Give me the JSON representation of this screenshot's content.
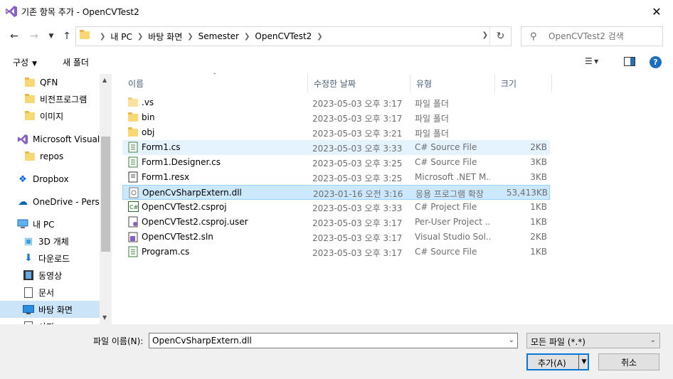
{
  "window": {
    "title": "기존 항목 추가 - OpenCVTest2",
    "close_glyph": "✕"
  },
  "address": {
    "crumbs": [
      "내 PC",
      "바탕 화면",
      "Semester",
      "OpenCVTest2"
    ],
    "search_placeholder": "OpenCVTest2 검색"
  },
  "toolbar": {
    "organize_label": "구성",
    "new_folder_label": "새 폴더",
    "help_label": "?"
  },
  "nav": {
    "items": [
      {
        "label": "QFN",
        "icon": "folder-icon"
      },
      {
        "label": "비전프로그램",
        "icon": "folder-icon"
      },
      {
        "label": "이미지",
        "icon": "folder-icon"
      },
      {
        "label": "Microsoft Visual S",
        "icon": "visual-studio-icon"
      },
      {
        "label": "repos",
        "icon": "folder-icon"
      },
      {
        "label": "Dropbox",
        "icon": "dropbox-icon"
      },
      {
        "label": "OneDrive - Person",
        "icon": "onedrive-icon"
      },
      {
        "label": "내 PC",
        "icon": "computer-icon"
      },
      {
        "label": "3D 개체",
        "icon": "3d-objects-icon"
      },
      {
        "label": "다운로드",
        "icon": "download-icon"
      },
      {
        "label": "동영상",
        "icon": "video-icon"
      },
      {
        "label": "문서",
        "icon": "documents-icon"
      },
      {
        "label": "바탕 화면",
        "icon": "desktop-icon"
      },
      {
        "label": "사진",
        "icon": "pictures-icon"
      }
    ]
  },
  "columns": {
    "name": "이름",
    "date": "수정한 날짜",
    "type": "유형",
    "size": "크기"
  },
  "files": [
    {
      "name": ".vs",
      "date": "2023-05-03 오후 3:17",
      "type": "파일 폴더",
      "size": "",
      "icon": "folder-icon"
    },
    {
      "name": "bin",
      "date": "2023-05-03 오후 3:17",
      "type": "파일 폴더",
      "size": "",
      "icon": "folder-icon"
    },
    {
      "name": "obj",
      "date": "2023-05-03 오후 3:21",
      "type": "파일 폴더",
      "size": "",
      "icon": "folder-icon"
    },
    {
      "name": "Form1.cs",
      "date": "2023-05-03 오후 3:33",
      "type": "C# Source File",
      "size": "2KB",
      "icon": "csharp-file-icon"
    },
    {
      "name": "Form1.Designer.cs",
      "date": "2023-05-03 오후 3:25",
      "type": "C# Source File",
      "size": "3KB",
      "icon": "csharp-file-icon"
    },
    {
      "name": "Form1.resx",
      "date": "2023-05-03 오후 3:25",
      "type": "Microsoft .NET M...",
      "size": "3KB",
      "icon": "resx-file-icon"
    },
    {
      "name": "OpenCvSharpExtern.dll",
      "date": "2023-01-16 오전 3:16",
      "type": "응용 프로그램 확장",
      "size": "53,413KB",
      "icon": "dll-file-icon"
    },
    {
      "name": "OpenCVTest2.csproj",
      "date": "2023-05-03 오후 3:33",
      "type": "C# Project File",
      "size": "1KB",
      "icon": "csproj-file-icon"
    },
    {
      "name": "OpenCVTest2.csproj.user",
      "date": "2023-05-03 오후 3:17",
      "type": "Per-User Project ...",
      "size": "1KB",
      "icon": "user-file-icon"
    },
    {
      "name": "OpenCVTest2.sln",
      "date": "2023-05-03 오후 3:17",
      "type": "Visual Studio Sol...",
      "size": "2KB",
      "icon": "sln-file-icon"
    },
    {
      "name": "Program.cs",
      "date": "2023-05-03 오후 3:17",
      "type": "C# Source File",
      "size": "1KB",
      "icon": "csharp-file-icon"
    }
  ],
  "footer": {
    "filename_label": "파일 이름(N):",
    "filename_value": "OpenCvSharpExtern.dll",
    "filetype_value": "모든 파일 (*.*)",
    "add_label": "추가(A)",
    "cancel_label": "취소"
  },
  "colors": {
    "selected_row": "#cce8ff",
    "hover_row": "#e5f3ff",
    "accent": "#0078d7"
  }
}
